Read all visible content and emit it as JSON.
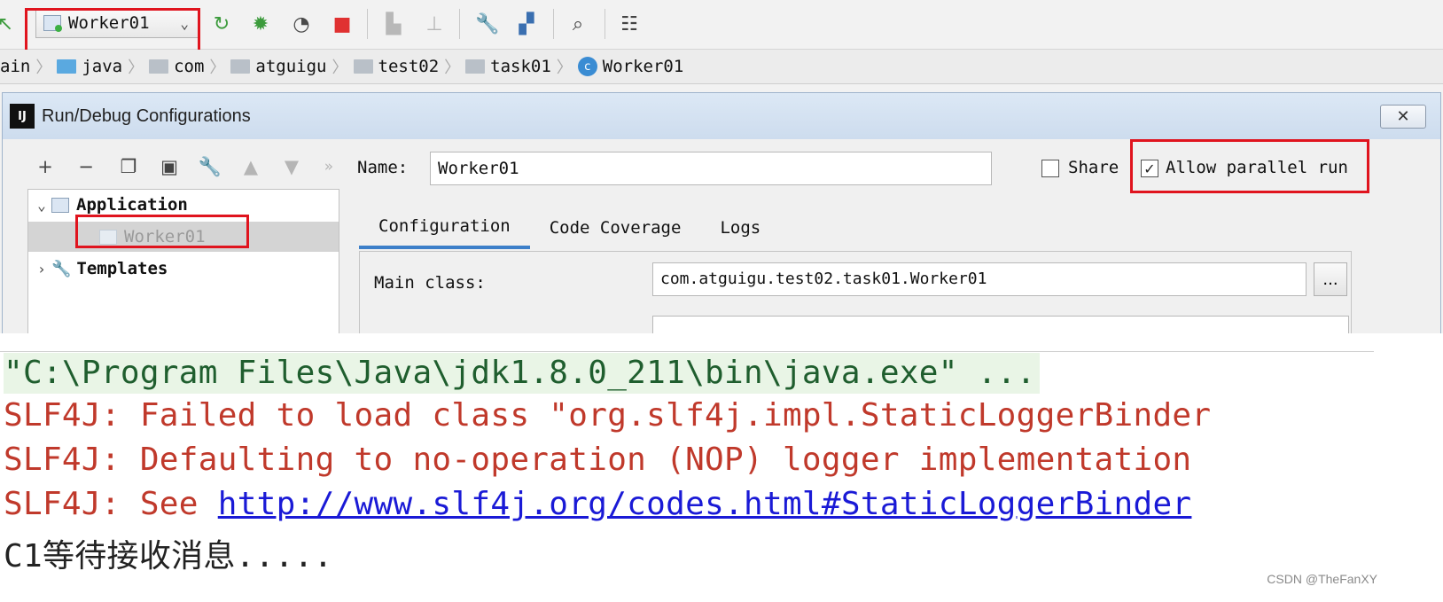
{
  "toolbar": {
    "run_config": "Worker01"
  },
  "breadcrumb": {
    "items": [
      "ain",
      "java",
      "com",
      "atguigu",
      "test02",
      "task01",
      "Worker01"
    ]
  },
  "dialog": {
    "title": "Run/Debug Configurations",
    "logo_text": "IJ",
    "close_glyph": "✕",
    "name_label": "Name:",
    "name_value": "Worker01",
    "share_label": "Share",
    "allow_parallel_label": "Allow parallel run",
    "allow_parallel_checked": true,
    "share_checked": false,
    "tree": {
      "application": "Application",
      "worker": "Worker01",
      "templates": "Templates"
    },
    "tabs": [
      "Configuration",
      "Code Coverage",
      "Logs"
    ],
    "active_tab": "Configuration",
    "main_class_label": "Main class:",
    "main_class_value": "com.atguigu.test02.task01.Worker01",
    "ellipsis": "..."
  },
  "console": {
    "command": "\"C:\\Program Files\\Java\\jdk1.8.0_211\\bin\\java.exe\" ...",
    "line1": "SLF4J: Failed to load class \"org.slf4j.impl.StaticLoggerBinder",
    "line2": "SLF4J: Defaulting to no-operation (NOP) logger implementation",
    "line3_prefix": "SLF4J: See ",
    "line3_link": "http://www.slf4j.org/codes.html#StaticLoggerBinder",
    "line4": "C1等待接收消息....."
  },
  "watermark": "CSDN @TheFanXY",
  "colors": {
    "highlight_box": "#e0141e",
    "console_error": "#c0392b",
    "console_link": "#1a1ad6",
    "active_tab": "#3d7fc9"
  }
}
